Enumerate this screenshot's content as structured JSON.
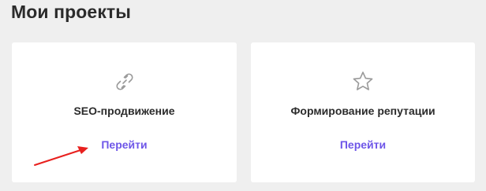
{
  "page": {
    "title": "Мои проекты"
  },
  "projects": [
    {
      "icon": "link-icon",
      "title": "SEO-продвижение",
      "link_label": "Перейти"
    },
    {
      "icon": "star-icon",
      "title": "Формирование репутации",
      "link_label": "Перейти"
    }
  ],
  "annotation": {
    "arrow_color": "#e8201e"
  },
  "colors": {
    "accent": "#6e56e8",
    "background": "#efefef",
    "card": "#ffffff"
  }
}
